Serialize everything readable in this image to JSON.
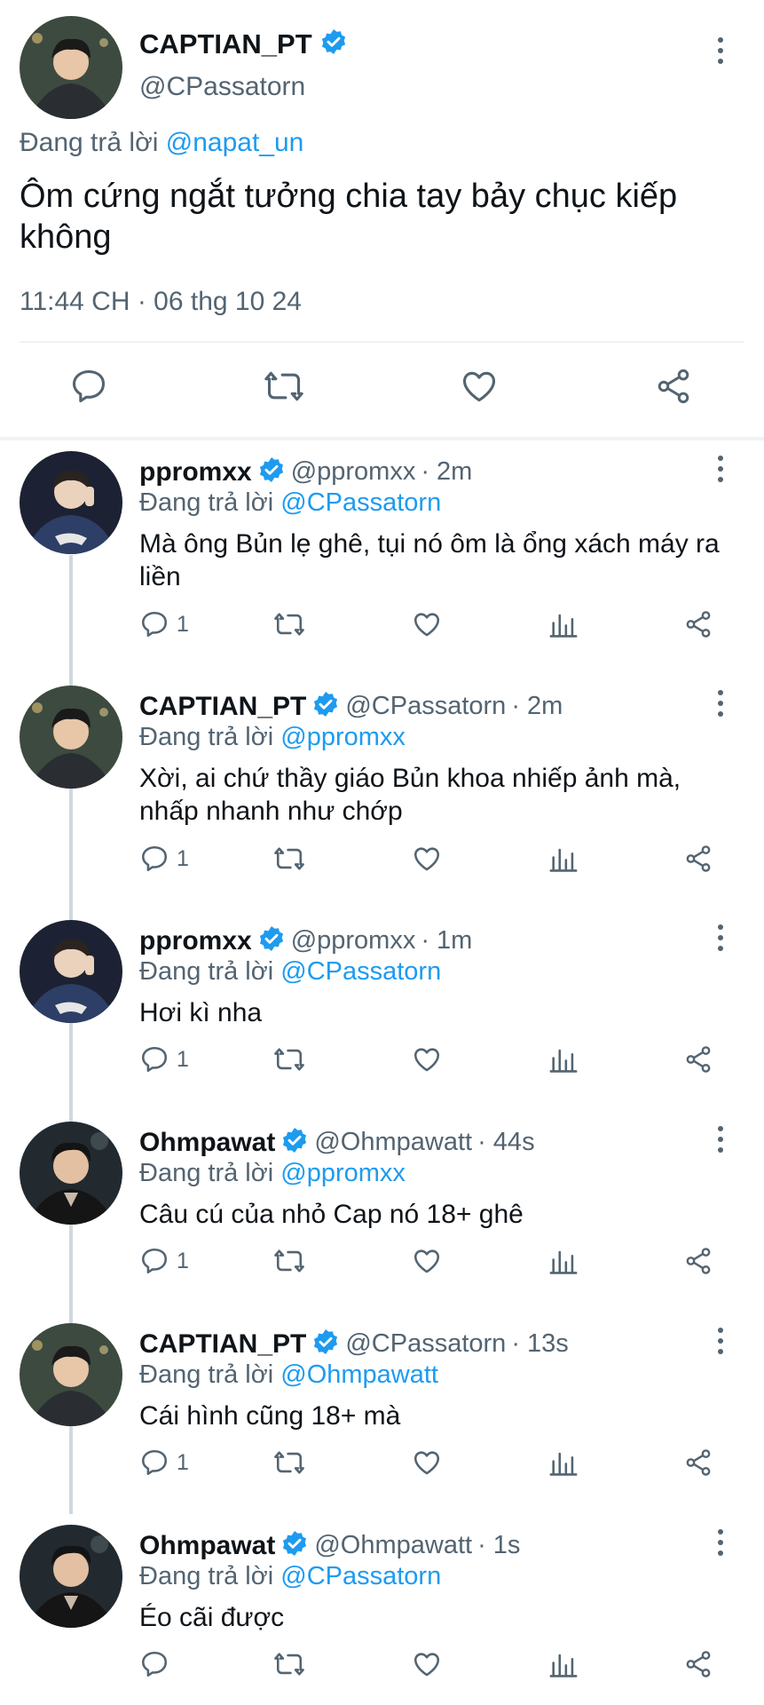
{
  "main_tweet": {
    "name": "CAPTIAN_PT",
    "handle": "@CPassatorn",
    "replying_prefix": "Đang trả lời",
    "replying_to": "@napat_un",
    "text": "Ôm cứng ngắt tưởng chia tay bảy chục kiếp không",
    "timestamp": "11:44 CH · 06 thg 10 24"
  },
  "replies": [
    {
      "name": "ppromxx",
      "handle": "@ppromxx",
      "time": "· 2m",
      "replying_prefix": "Đang trả lời",
      "replying_to": "@CPassatorn",
      "text": "Mà ông Bủn lẹ ghê, tụi nó ôm là ổng xách máy ra liền",
      "reply_count": "1",
      "avatar": "ppromxx"
    },
    {
      "name": "CAPTIAN_PT",
      "handle": "@CPassatorn",
      "time": "· 2m",
      "replying_prefix": "Đang trả lời",
      "replying_to": "@ppromxx",
      "text": "Xời, ai chứ thầy giáo Bủn khoa nhiếp ảnh mà, nhấp nhanh như chớp",
      "reply_count": "1",
      "avatar": "captian"
    },
    {
      "name": "ppromxx",
      "handle": "@ppromxx",
      "time": "· 1m",
      "replying_prefix": "Đang trả lời",
      "replying_to": "@CPassatorn",
      "text": "Hơi kì nha",
      "reply_count": "1",
      "avatar": "ppromxx"
    },
    {
      "name": "Ohmpawat",
      "handle": "@Ohmpawatt",
      "time": "· 44s",
      "replying_prefix": "Đang trả lời",
      "replying_to": "@ppromxx",
      "text": "Câu cú của nhỏ Cap nó 18+ ghê",
      "reply_count": "1",
      "avatar": "ohm"
    },
    {
      "name": "CAPTIAN_PT",
      "handle": "@CPassatorn",
      "time": "· 13s",
      "replying_prefix": "Đang trả lời",
      "replying_to": "@Ohmpawatt",
      "text": "Cái hình cũng 18+ mà",
      "reply_count": "1",
      "avatar": "captian"
    },
    {
      "name": "Ohmpawat",
      "handle": "@Ohmpawatt",
      "time": "· 1s",
      "replying_prefix": "Đang trả lời",
      "replying_to": "@CPassatorn",
      "text": "Éo cãi được",
      "reply_count": "",
      "avatar": "ohm"
    }
  ],
  "colors": {
    "accent": "#1d9bf0",
    "muted": "#536471",
    "text": "#0f1419",
    "divider": "#eff3f4"
  }
}
